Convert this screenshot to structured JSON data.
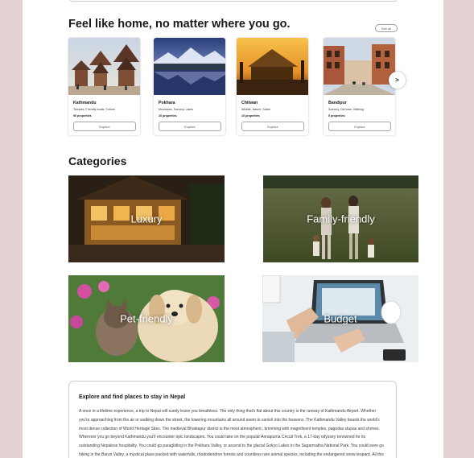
{
  "destinations": {
    "title": "Feel like home, no matter where you go.",
    "see_all": "See all",
    "next": ">",
    "cards": [
      {
        "name": "Kathmandu",
        "tags": "Temples, Friendly locals, Culture",
        "properties": "90 properties",
        "button": "Explore"
      },
      {
        "name": "Pokhara",
        "tags": "Mountains, Scenery, Lakes",
        "properties": "20 properties",
        "button": "Explore"
      },
      {
        "name": "Chitwan",
        "tags": "Wildlife, Nature, Safari",
        "properties": "10 properties",
        "button": "Explore"
      },
      {
        "name": "Bandipur",
        "tags": "Scenery, Old town, Walking",
        "properties": "5 properties",
        "button": "Explore"
      }
    ]
  },
  "categories": {
    "title": "Categories",
    "items": [
      {
        "label": "Luxury"
      },
      {
        "label": "Family-friendly"
      },
      {
        "label": "Pet-friendly"
      },
      {
        "label": "Budget"
      }
    ]
  },
  "info": {
    "heading": "Explore and find places to stay in Nepal",
    "body": "A once in a lifetime experience, a trip to Nepal will surely leave you breathless. The only thing that's flat about this country is the runway of Kathmandu Airport. Whether you're approaching from the air or walking down the street, the towering mountains all around seem to vanish into the heavens. The Kathmandu Valley boasts the world's most dense collection of World Heritage Sites. The medieval Bhaktapur district is the most atmospheric, brimming with magnificent temples, pagodas stupas and shrines. Wherever you go beyond Kathmandu you'll encounter epic landscapes. You could take on the popular Annapurna Circuit Trek, a 17-day odyssey renowned for its outstanding Nepalese hospitality. You could go paragliding in the Pokhara Valley, or ascend to the glacial Gokyo Lakes in the Sagarmatha National Park. You could even go hiking in the Barun Valley, a mystical place packed with waterfalls, rhododendron forests and countless rare animal species, including the endangered snow leopard. All this is in addition to what"
  }
}
